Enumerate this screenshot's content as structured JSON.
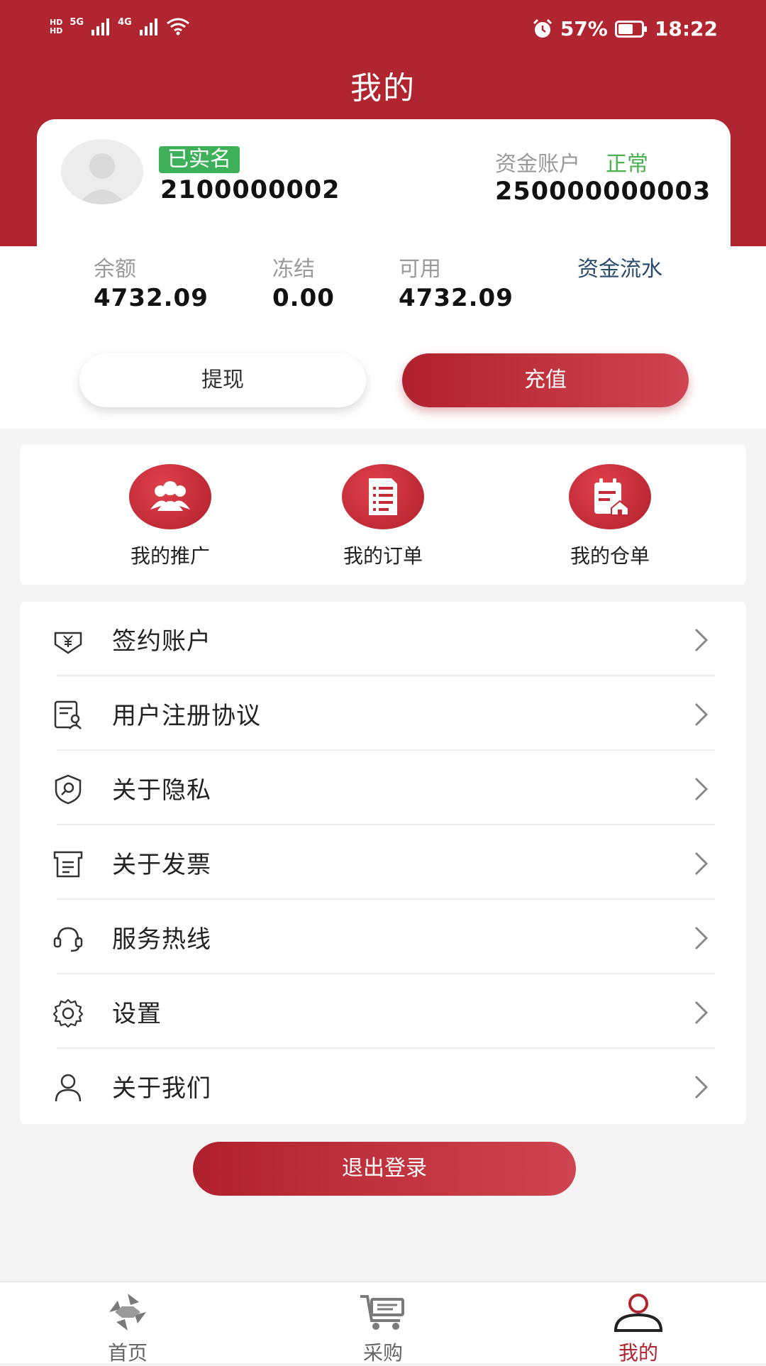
{
  "status_bar": {
    "left_labels": [
      "HD",
      "HD",
      "5G",
      "4G"
    ],
    "battery": "57%",
    "time": "18:22"
  },
  "header": {
    "title": "我的"
  },
  "account": {
    "verified_badge": "已实名",
    "user_id": "2100000002",
    "fund_account_label": "资金账户",
    "fund_account_status": "正常",
    "fund_account_no": "250000000003"
  },
  "stats": [
    {
      "label": "余额",
      "value": "4732.09"
    },
    {
      "label": "冻结",
      "value": "0.00"
    },
    {
      "label": "可用",
      "value": "4732.09"
    }
  ],
  "fund_flow_link": "资金流水",
  "actions": {
    "withdraw": "提现",
    "recharge": "充值"
  },
  "quick_links": [
    {
      "label": "我的推广",
      "icon": "users-icon"
    },
    {
      "label": "我的订单",
      "icon": "document-list-icon"
    },
    {
      "label": "我的仓单",
      "icon": "warehouse-receipt-icon"
    }
  ],
  "menu": [
    {
      "label": "签约账户",
      "icon": "signed-account-icon"
    },
    {
      "label": "用户注册协议",
      "icon": "agreement-icon"
    },
    {
      "label": "关于隐私",
      "icon": "privacy-shield-icon"
    },
    {
      "label": "关于发票",
      "icon": "invoice-icon"
    },
    {
      "label": "服务热线",
      "icon": "headset-icon"
    },
    {
      "label": "设置",
      "icon": "gear-icon"
    },
    {
      "label": "关于我们",
      "icon": "person-icon"
    }
  ],
  "logout": "退出登录",
  "tabbar": [
    {
      "label": "首页",
      "icon": "home-icon"
    },
    {
      "label": "采购",
      "icon": "cart-icon"
    },
    {
      "label": "我的",
      "icon": "profile-icon",
      "active": true
    }
  ],
  "colors": {
    "brand_red": "#b0252f",
    "verified_green": "#3fb05a",
    "status_green": "#4ab24e",
    "link_navy": "#2a4c6a"
  }
}
